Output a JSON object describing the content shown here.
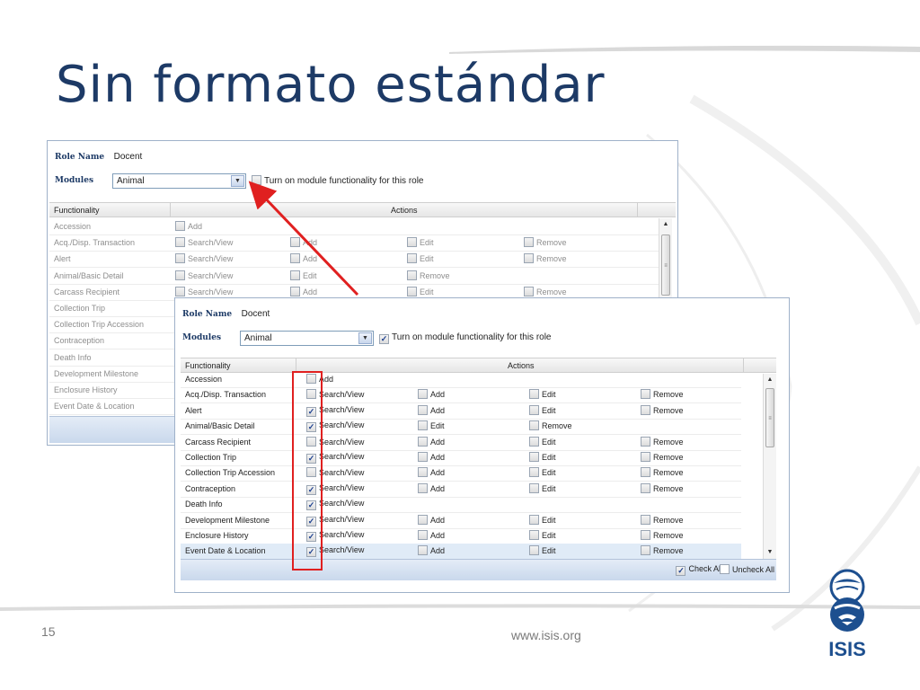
{
  "slide": {
    "title": "Sin formato estándar",
    "page_number": "15",
    "url": "www.isis.org",
    "logo_text": "ISIS"
  },
  "back_panel": {
    "role_name_label": "Role Name",
    "role_name_value": "Docent",
    "modules_label": "Modules",
    "modules_value": "Animal",
    "turn_on_label": "Turn on module functionality for this role",
    "turn_on_checked": false,
    "col_functionality": "Functionality",
    "col_actions": "Actions",
    "rows": [
      {
        "name": "Accession",
        "actions": [
          "Add"
        ]
      },
      {
        "name": "Acq./Disp. Transaction",
        "actions": [
          "Search/View",
          "Add",
          "Edit",
          "Remove"
        ]
      },
      {
        "name": "Alert",
        "actions": [
          "Search/View",
          "Add",
          "Edit",
          "Remove"
        ]
      },
      {
        "name": "Animal/Basic Detail",
        "actions": [
          "Search/View",
          "Edit",
          "Remove"
        ]
      },
      {
        "name": "Carcass Recipient",
        "actions": [
          "Search/View",
          "Add",
          "Edit",
          "Remove"
        ]
      },
      {
        "name": "Collection Trip",
        "actions": []
      },
      {
        "name": "Collection Trip Accession",
        "actions": []
      },
      {
        "name": "Contraception",
        "actions": []
      },
      {
        "name": "Death Info",
        "actions": []
      },
      {
        "name": "Development Milestone",
        "actions": []
      },
      {
        "name": "Enclosure History",
        "actions": []
      },
      {
        "name": "Event Date & Location",
        "actions": []
      }
    ]
  },
  "front_panel": {
    "role_name_label": "Role Name",
    "role_name_value": "Docent",
    "modules_label": "Modules",
    "modules_value": "Animal",
    "turn_on_label": "Turn on module functionality for this role",
    "turn_on_checked": true,
    "col_functionality": "Functionality",
    "col_actions": "Actions",
    "check_all_label": "Check All",
    "uncheck_all_label": "Uncheck All",
    "rows": [
      {
        "name": "Accession",
        "actions": [
          {
            "label": "Add",
            "checked": false
          }
        ]
      },
      {
        "name": "Acq./Disp. Transaction",
        "actions": [
          {
            "label": "Search/View",
            "checked": false
          },
          {
            "label": "Add",
            "checked": false
          },
          {
            "label": "Edit",
            "checked": false
          },
          {
            "label": "Remove",
            "checked": false
          }
        ]
      },
      {
        "name": "Alert",
        "actions": [
          {
            "label": "Search/View",
            "checked": true
          },
          {
            "label": "Add",
            "checked": false
          },
          {
            "label": "Edit",
            "checked": false
          },
          {
            "label": "Remove",
            "checked": false
          }
        ]
      },
      {
        "name": "Animal/Basic Detail",
        "actions": [
          {
            "label": "Search/View",
            "checked": true
          },
          {
            "label": "Edit",
            "checked": false
          },
          {
            "label": "Remove",
            "checked": false
          }
        ]
      },
      {
        "name": "Carcass Recipient",
        "actions": [
          {
            "label": "Search/View",
            "checked": false
          },
          {
            "label": "Add",
            "checked": false
          },
          {
            "label": "Edit",
            "checked": false
          },
          {
            "label": "Remove",
            "checked": false
          }
        ]
      },
      {
        "name": "Collection Trip",
        "actions": [
          {
            "label": "Search/View",
            "checked": true
          },
          {
            "label": "Add",
            "checked": false
          },
          {
            "label": "Edit",
            "checked": false
          },
          {
            "label": "Remove",
            "checked": false
          }
        ]
      },
      {
        "name": "Collection Trip Accession",
        "actions": [
          {
            "label": "Search/View",
            "checked": false
          },
          {
            "label": "Add",
            "checked": false
          },
          {
            "label": "Edit",
            "checked": false
          },
          {
            "label": "Remove",
            "checked": false
          }
        ]
      },
      {
        "name": "Contraception",
        "actions": [
          {
            "label": "Search/View",
            "checked": true
          },
          {
            "label": "Add",
            "checked": false
          },
          {
            "label": "Edit",
            "checked": false
          },
          {
            "label": "Remove",
            "checked": false
          }
        ]
      },
      {
        "name": "Death Info",
        "actions": [
          {
            "label": "Search/View",
            "checked": true
          }
        ]
      },
      {
        "name": "Development Milestone",
        "actions": [
          {
            "label": "Search/View",
            "checked": true
          },
          {
            "label": "Add",
            "checked": false
          },
          {
            "label": "Edit",
            "checked": false
          },
          {
            "label": "Remove",
            "checked": false
          }
        ]
      },
      {
        "name": "Enclosure History",
        "actions": [
          {
            "label": "Search/View",
            "checked": true
          },
          {
            "label": "Add",
            "checked": false
          },
          {
            "label": "Edit",
            "checked": false
          },
          {
            "label": "Remove",
            "checked": false
          }
        ]
      },
      {
        "name": "Event Date & Location",
        "actions": [
          {
            "label": "Search/View",
            "checked": true
          },
          {
            "label": "Add",
            "checked": false
          },
          {
            "label": "Edit",
            "checked": false
          },
          {
            "label": "Remove",
            "checked": false
          }
        ],
        "highlighted": true
      }
    ]
  },
  "colors": {
    "title": "#1d3a66",
    "label_blue": "#1d3a66",
    "annotation_red": "#e02020",
    "highlight_row": "#e0ebf7"
  },
  "icons": {
    "select_arrow": "chevron-down-icon",
    "scroll_up": "scroll-up-icon",
    "scroll_down": "scroll-down-icon",
    "logo": "isis-globe-logo"
  }
}
